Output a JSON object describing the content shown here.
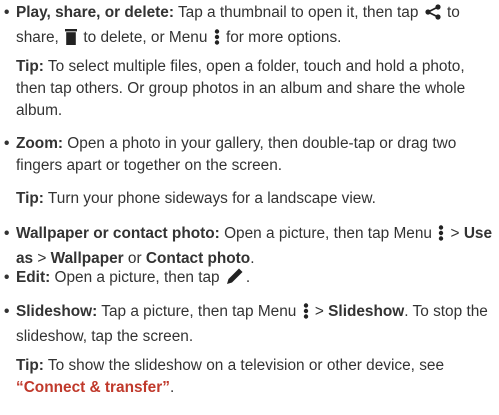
{
  "items": [
    {
      "title": "Play, share, or delete:",
      "t1": " Tap a thumbnail to open it, then tap ",
      "t2": " to share, ",
      "t3": " to delete, or Menu ",
      "t4": " for more options."
    },
    {
      "title": "Zoom:",
      "text": " Open a photo in your gallery, then double-tap or drag two fingers apart or together on the screen."
    },
    {
      "title": "Wallpaper or contact photo:",
      "t1": " Open a picture, then tap Menu ",
      "sep1": " > ",
      "use_as": "Use as",
      "sep2": " > ",
      "wallpaper": "Wallpaper",
      "or": " or ",
      "contact_photo": "Contact photo",
      "end": "."
    },
    {
      "title": "Edit:",
      "t1": " Open a picture, then tap ",
      "end": "."
    },
    {
      "title": "Slideshow:",
      "t1": " Tap a picture, then tap Menu ",
      "sep": " > ",
      "slideshow": "Slideshow",
      "t2": ". To stop the slideshow, tap the screen."
    }
  ],
  "tips": [
    {
      "label": "Tip:",
      "text": " To select multiple files, open a folder, touch and hold a photo, then tap others. Or group photos in an album and share the whole album."
    },
    {
      "label": "Tip:",
      "text": " Turn your phone sideways for a landscape view."
    },
    {
      "label": "Tip:",
      "text": " To show the slideshow on a television or other device, see ",
      "link": "“Connect & transfer”",
      "end": "."
    }
  ],
  "bullet_char": "•",
  "icons": [
    "share-icon",
    "trash-icon",
    "menu-icon",
    "pencil-icon"
  ],
  "colors": {
    "text": "#333333",
    "link": "#c0392b"
  }
}
